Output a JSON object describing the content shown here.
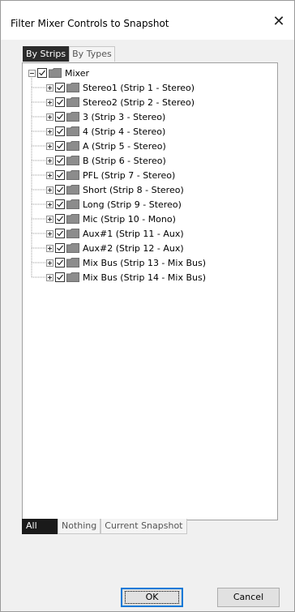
{
  "window": {
    "title": "Filter Mixer Controls to Snapshot",
    "close_glyph": "✕"
  },
  "tabs_top": [
    {
      "label": "By Strips",
      "active": true
    },
    {
      "label": "By Types",
      "active": false
    }
  ],
  "tree": {
    "root_label": "Mixer",
    "items": [
      "Stereo1 (Strip 1 - Stereo)",
      "Stereo2 (Strip 2 - Stereo)",
      "3 (Strip 3 - Stereo)",
      "4 (Strip 4 - Stereo)",
      "A (Strip 5 - Stereo)",
      "B (Strip 6 - Stereo)",
      "PFL (Strip 7 - Stereo)",
      "Short (Strip 8 - Stereo)",
      "Long (Strip 9 - Stereo)",
      "Mic (Strip 10 - Mono)",
      "Aux#1 (Strip 11 - Aux)",
      "Aux#2 (Strip 12 - Aux)",
      "Mix Bus (Strip 13 - Mix Bus)",
      "Mix Bus (Strip 14 - Mix Bus)"
    ]
  },
  "tabs_bottom": [
    {
      "label": "All",
      "active": true
    },
    {
      "label": "Nothing",
      "active": false
    },
    {
      "label": "Current Snapshot",
      "active": false
    }
  ],
  "buttons": {
    "ok": "OK",
    "cancel": "Cancel"
  },
  "colors": {
    "checkbox_border": "#333333",
    "folder": "#8c8c8c",
    "active_tab": "#2b2b2b"
  }
}
